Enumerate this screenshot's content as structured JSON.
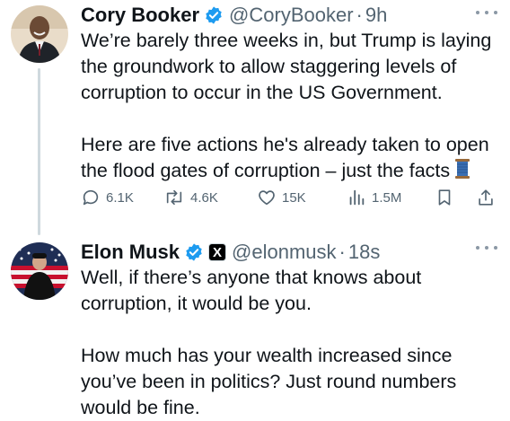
{
  "tweets": [
    {
      "author_name": "Cory Booker",
      "handle": "@CoryBooker",
      "separator": "·",
      "time": "9h",
      "verified": true,
      "body": [
        "We’re barely three weeks in, but Trump is laying the groundwork to allow staggering levels of corruption to occur in the US Government.",
        "Here are five actions he's already taken to open the flood gates of corruption – just the facts"
      ],
      "emoji_icon": "thread-spool-icon",
      "stats": {
        "replies": "6.1K",
        "reposts": "4.6K",
        "likes": "15K",
        "views": "1.5M"
      }
    },
    {
      "author_name": "Elon Musk",
      "handle": "@elonmusk",
      "separator": "·",
      "time": "18s",
      "verified": true,
      "affiliate_badge": "X",
      "body": [
        "Well, if there’s anyone that knows about corruption, it would be you.",
        "How much has your wealth increased since you’ve been in politics? Just round numbers would be fine."
      ]
    }
  ],
  "colors": {
    "verified_blue": "#1d9bf0",
    "secondary_text": "#536471",
    "thread_line": "#cfd9de"
  }
}
